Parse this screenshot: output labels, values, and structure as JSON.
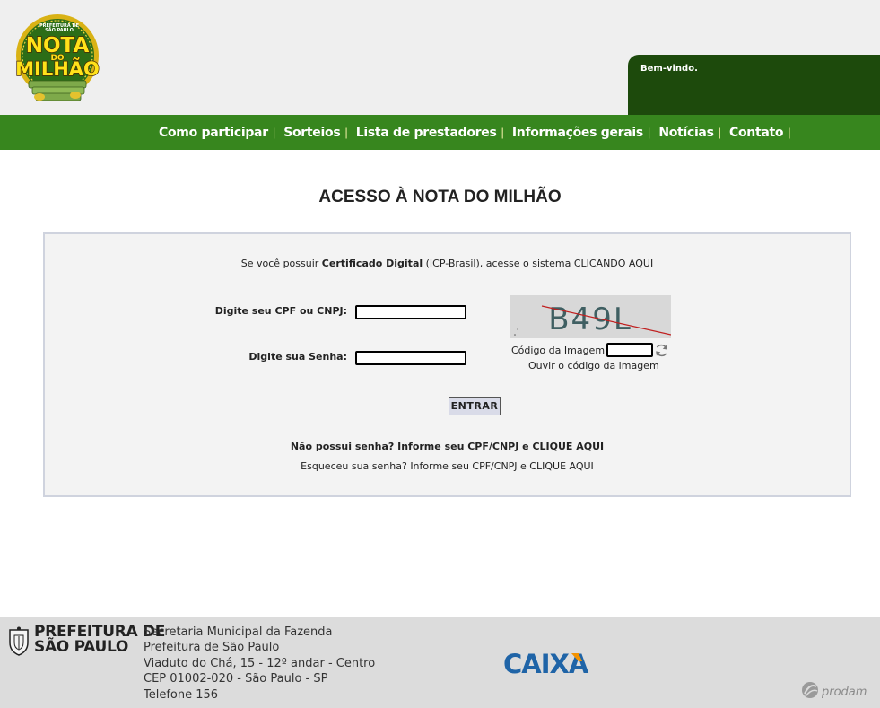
{
  "header": {
    "logo_lines": [
      "PREFEITURA DE",
      "SÃO PAULO",
      "NOTA",
      "DO",
      "MILHÃO"
    ],
    "welcome": "Bem-vindo."
  },
  "nav": {
    "items": [
      {
        "label": "Como participar"
      },
      {
        "label": "Sorteios"
      },
      {
        "label": "Lista de prestadores"
      },
      {
        "label": "Informações gerais"
      },
      {
        "label": "Notícias"
      },
      {
        "label": "Contato"
      }
    ],
    "separator": "|"
  },
  "page": {
    "title": "ACESSO À NOTA DO MILHÃO"
  },
  "login": {
    "cert_prefix": "Se você possuir ",
    "cert_bold": "Certificado Digital",
    "cert_suffix": " (ICP-Brasil), acesse o sistema CLICANDO AQUI",
    "cpf_label": "Digite seu CPF ou CNPJ:",
    "cpf_value": "",
    "password_label": "Digite sua Senha:",
    "password_value": "",
    "captcha_text": "B49L",
    "captcha_label": "Código da Imagem:",
    "captcha_value": "",
    "audio_link": "Ouvir o código da imagem",
    "submit_label": "ENTRAR",
    "no_password_text": "Não possui senha? Informe seu CPF/CNPJ e CLIQUE AQUI",
    "forgot_password_text": "Esqueceu sua senha? Informe seu CPF/CNPJ e  CLIQUE AQUI"
  },
  "footer": {
    "org_line1": "PREFEITURA DE",
    "org_line2": "SÃO PAULO",
    "address": [
      "Secretaria Municipal da Fazenda",
      "Prefeitura de São Paulo",
      "Viaduto do Chá, 15 - 12º andar - Centro",
      "CEP 01002-020 - São Paulo - SP",
      "Telefone 156"
    ],
    "caixa_logo_text": "CAIXA",
    "prodam_logo_text": "prodam"
  },
  "colors": {
    "nav_green": "#37861e",
    "welcome_green": "#1d4a0c",
    "caixa_blue": "#1f64a7",
    "caixa_orange": "#f39200"
  }
}
